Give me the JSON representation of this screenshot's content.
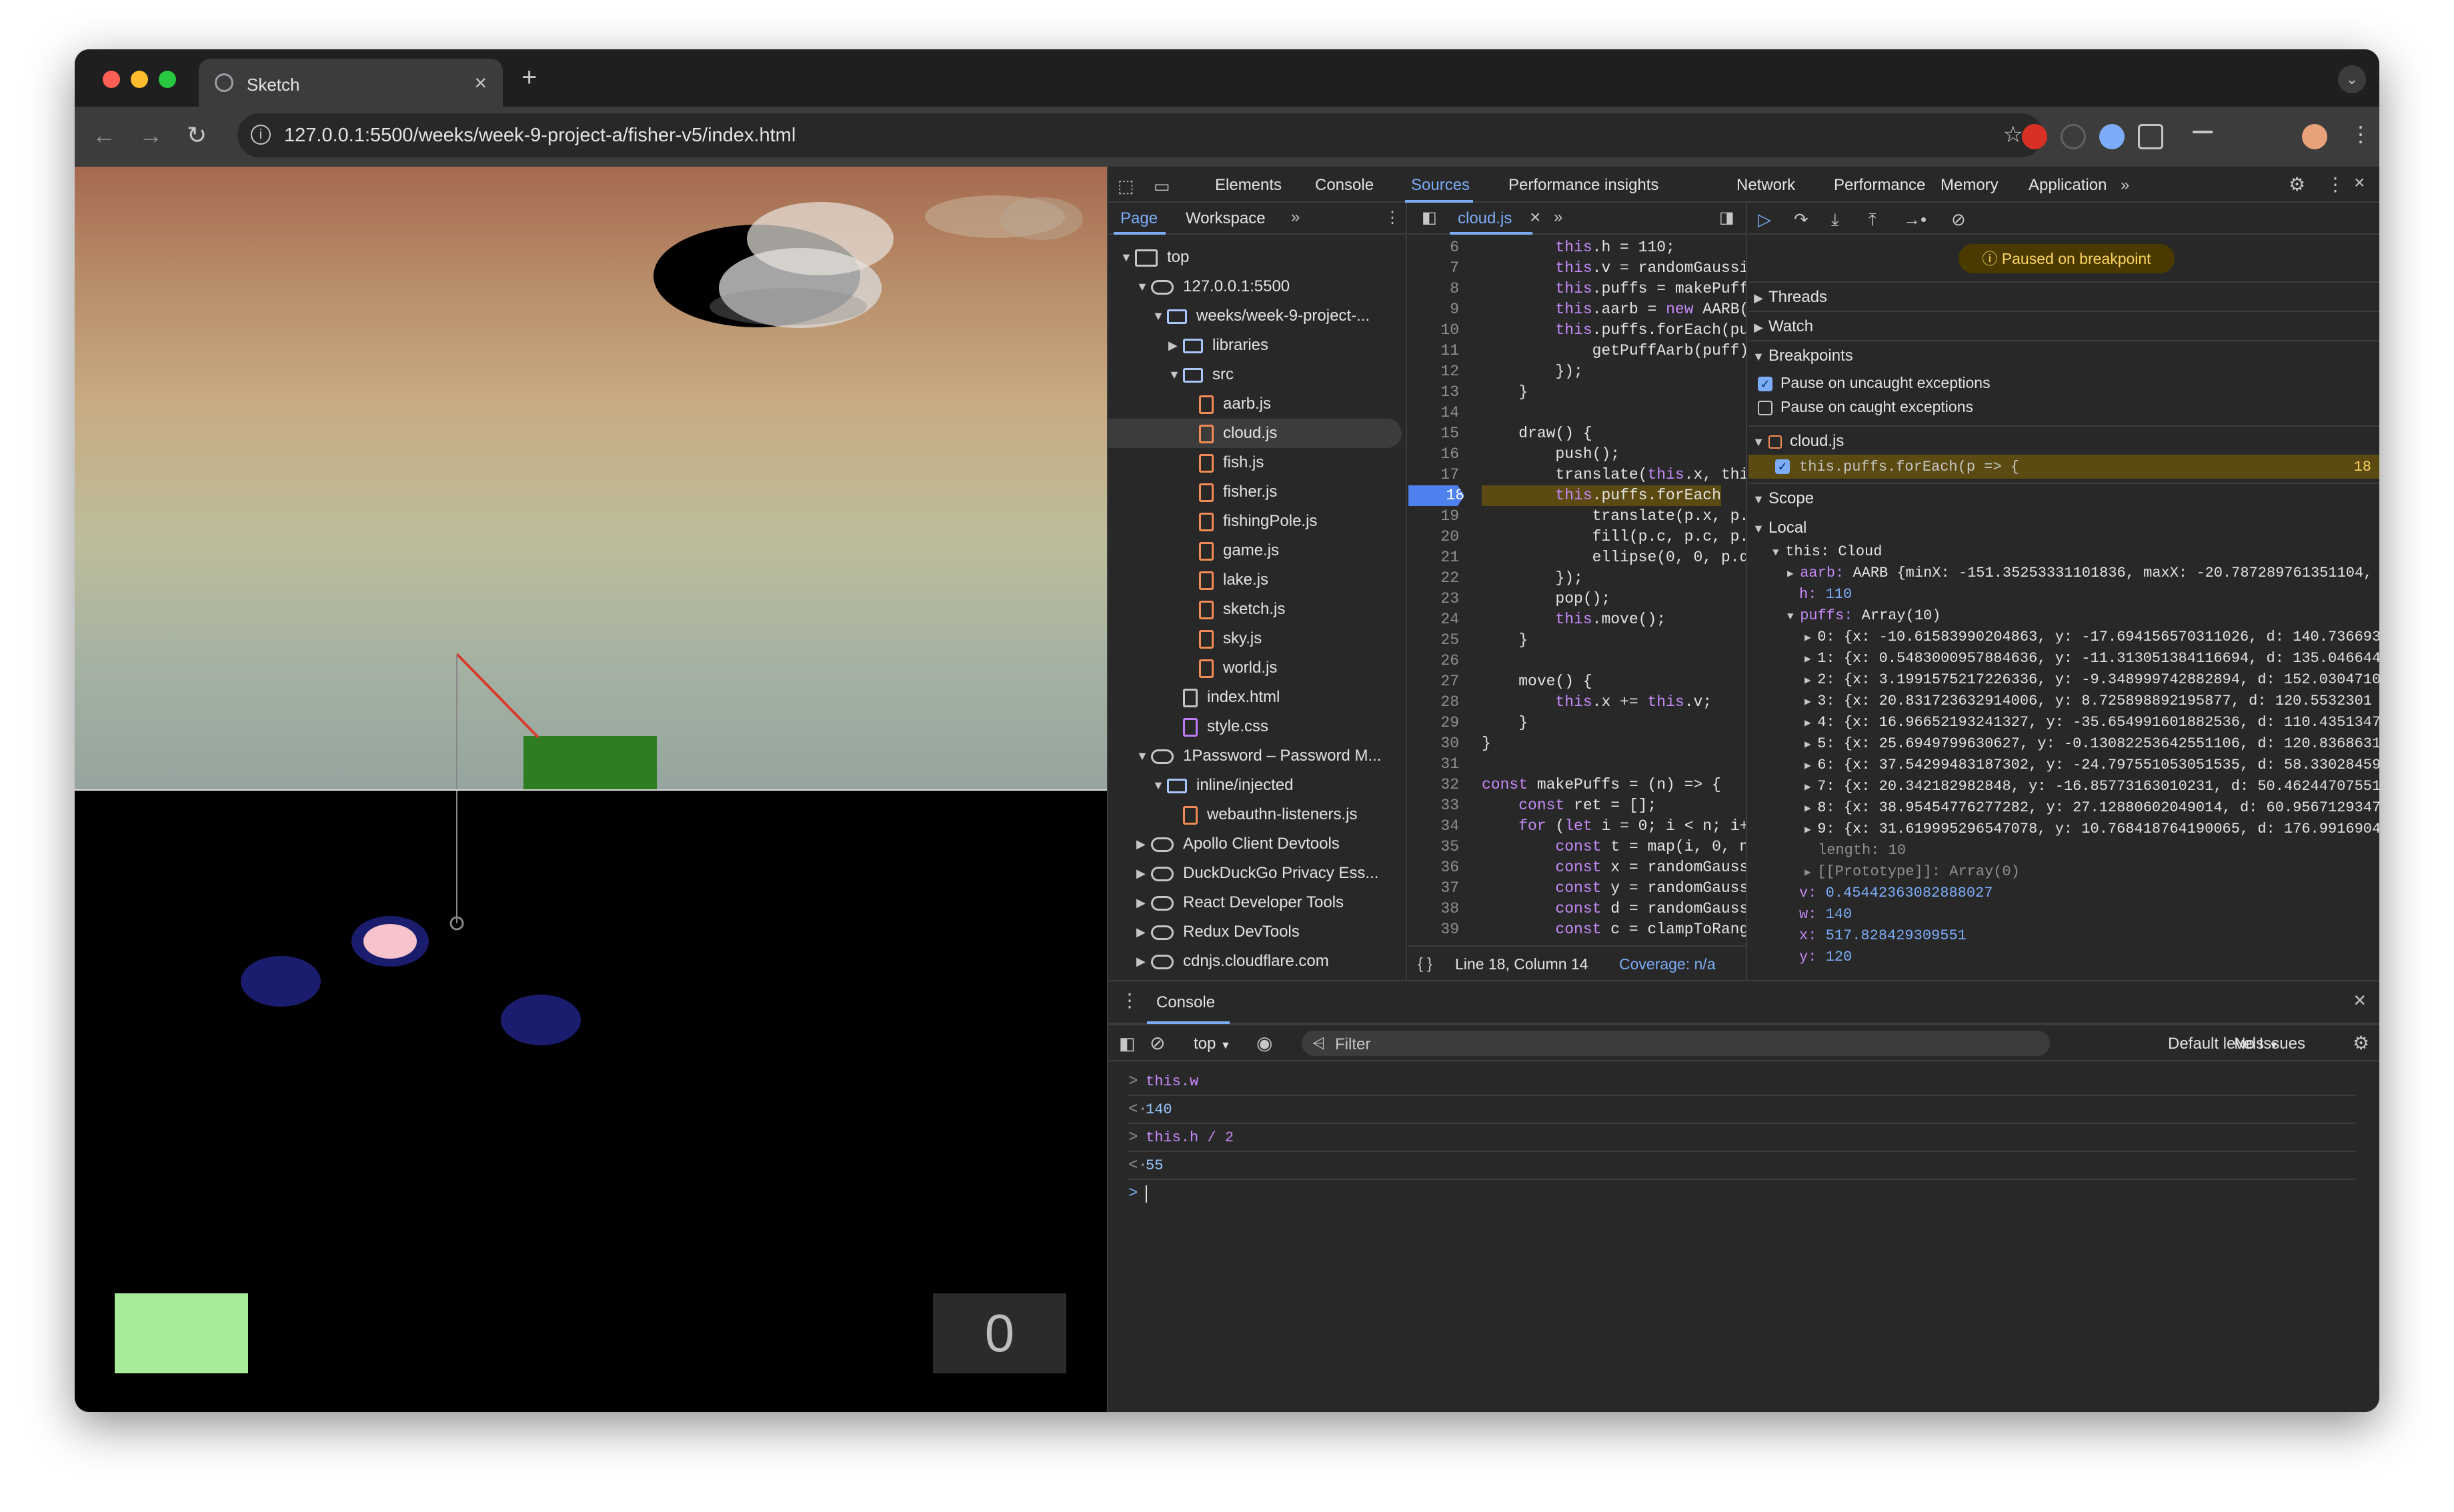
{
  "browser": {
    "tab_title": "Sketch",
    "url": "127.0.0.1:5500/weeks/week-9-project-a/fisher-v5/index.html"
  },
  "sketch": {
    "score": "0"
  },
  "devtools": {
    "tabs": [
      "Elements",
      "Console",
      "Sources",
      "Performance insights",
      "Network",
      "Performance",
      "Memory",
      "Application"
    ],
    "selected_tab": "Sources",
    "navigator_tabs": [
      "Page",
      "Workspace"
    ],
    "tree": [
      {
        "label": "top",
        "indent": 0,
        "kind": "frame",
        "arrow": "down"
      },
      {
        "label": "127.0.0.1:5500",
        "indent": 1,
        "kind": "cloud",
        "arrow": "down"
      },
      {
        "label": "weeks/week-9-project-...",
        "indent": 2,
        "kind": "folder",
        "arrow": "down"
      },
      {
        "label": "libraries",
        "indent": 3,
        "kind": "folder",
        "arrow": "right"
      },
      {
        "label": "src",
        "indent": 3,
        "kind": "folder",
        "arrow": "down"
      },
      {
        "label": "aarb.js",
        "indent": 4,
        "kind": "js"
      },
      {
        "label": "cloud.js",
        "indent": 4,
        "kind": "js",
        "selected": true
      },
      {
        "label": "fish.js",
        "indent": 4,
        "kind": "js"
      },
      {
        "label": "fisher.js",
        "indent": 4,
        "kind": "js"
      },
      {
        "label": "fishingPole.js",
        "indent": 4,
        "kind": "js"
      },
      {
        "label": "game.js",
        "indent": 4,
        "kind": "js"
      },
      {
        "label": "lake.js",
        "indent": 4,
        "kind": "js"
      },
      {
        "label": "sketch.js",
        "indent": 4,
        "kind": "js"
      },
      {
        "label": "sky.js",
        "indent": 4,
        "kind": "js"
      },
      {
        "label": "world.js",
        "indent": 4,
        "kind": "js"
      },
      {
        "label": "index.html",
        "indent": 3,
        "kind": "html"
      },
      {
        "label": "style.css",
        "indent": 3,
        "kind": "css"
      },
      {
        "label": "1Password – Password M...",
        "indent": 1,
        "kind": "cloud",
        "arrow": "down"
      },
      {
        "label": "inline/injected",
        "indent": 2,
        "kind": "folder",
        "arrow": "down"
      },
      {
        "label": "webauthn-listeners.js",
        "indent": 3,
        "kind": "js"
      },
      {
        "label": "Apollo Client Devtools",
        "indent": 1,
        "kind": "cloud",
        "arrow": "right"
      },
      {
        "label": "DuckDuckGo Privacy Ess...",
        "indent": 1,
        "kind": "cloud",
        "arrow": "right"
      },
      {
        "label": "React Developer Tools",
        "indent": 1,
        "kind": "cloud",
        "arrow": "right"
      },
      {
        "label": "Redux DevTools",
        "indent": 1,
        "kind": "cloud",
        "arrow": "right"
      },
      {
        "label": "cdnjs.cloudflare.com",
        "indent": 1,
        "kind": "cloud",
        "arrow": "right"
      }
    ],
    "editor": {
      "file_tab": "cloud.js",
      "lines": [
        {
          "n": "6",
          "code": "        this.h = 110;"
        },
        {
          "n": "7",
          "code": "        this.v = randomGaussi"
        },
        {
          "n": "8",
          "code": "        this.puffs = makePuff"
        },
        {
          "n": "9",
          "code": "        this.aarb = new AARB("
        },
        {
          "n": "10",
          "code": "        this.puffs.forEach(pu"
        },
        {
          "n": "11",
          "code": "            getPuffAarb(puff)"
        },
        {
          "n": "12",
          "code": "        });"
        },
        {
          "n": "13",
          "code": "    }"
        },
        {
          "n": "14",
          "code": ""
        },
        {
          "n": "15",
          "code": "    draw() {"
        },
        {
          "n": "16",
          "code": "        push();"
        },
        {
          "n": "17",
          "code": "        translate(this.x, thi"
        },
        {
          "n": "18",
          "code": "        this.puffs.forEach",
          "bp": true
        },
        {
          "n": "19",
          "code": "            translate(p.x, p."
        },
        {
          "n": "20",
          "code": "            fill(p.c, p.c, p."
        },
        {
          "n": "21",
          "code": "            ellipse(0, 0, p.d"
        },
        {
          "n": "22",
          "code": "        });"
        },
        {
          "n": "23",
          "code": "        pop();"
        },
        {
          "n": "24",
          "code": "        this.move();"
        },
        {
          "n": "25",
          "code": "    }"
        },
        {
          "n": "26",
          "code": ""
        },
        {
          "n": "27",
          "code": "    move() {"
        },
        {
          "n": "28",
          "code": "        this.x += this.v;"
        },
        {
          "n": "29",
          "code": "    }"
        },
        {
          "n": "30",
          "code": "}"
        },
        {
          "n": "31",
          "code": ""
        },
        {
          "n": "32",
          "code": "const makePuffs = (n) => {"
        },
        {
          "n": "33",
          "code": "    const ret = [];"
        },
        {
          "n": "34",
          "code": "    for (let i = 0; i < n; i+"
        },
        {
          "n": "35",
          "code": "        const t = map(i, 0, n"
        },
        {
          "n": "36",
          "code": "        const x = randomGauss"
        },
        {
          "n": "37",
          "code": "        const y = randomGauss"
        },
        {
          "n": "38",
          "code": "        const d = randomGauss"
        },
        {
          "n": "39",
          "code": "        const c = clampToRang"
        }
      ],
      "status_position": "Line 18, Column 14",
      "status_coverage": "Coverage: n/a"
    },
    "debugger": {
      "paused_label": "Paused on breakpoint",
      "threads": "Threads",
      "watch": "Watch",
      "breakpoints": "Breakpoints",
      "pause_uncaught": "Pause on uncaught exceptions",
      "pause_caught": "Pause on caught exceptions",
      "bp_file": "cloud.js",
      "bp_code": "this.puffs.forEach(p => {",
      "bp_line": "18",
      "scope": "Scope",
      "local": "Local",
      "this_label": "this: Cloud",
      "aarb_key": "aarb:",
      "aarb_val": "AARB {minX: -151.35253331101836, maxX: -20.787289761351104,",
      "h_key": "h:",
      "h_val": "110",
      "puffs_key": "puffs:",
      "puffs_val": "Array(10)",
      "puffs": [
        "0: {x: -10.61583990204863, y: -17.694156570311026, d: 140.736693",
        "1: {x: 0.5483000957884636, y: -11.313051384116694, d: 135.046644",
        "2: {x: 3.1991575217226336, y: -9.348999742882894, d: 152.0304710",
        "3: {x: 20.831723632914006, y: 8.725898892195877, d: 120.5532301",
        "4: {x: 16.96652193241327, y: -35.654991601882536, d: 110.4351347",
        "5: {x: 25.6949799630627, y: -0.13082253642551106, d: 120.8368631",
        "6: {x: 37.54299483187302, y: -24.797551053051535, d: 58.33028459",
        "7: {x: 20.342182982848, y: -16.85773163010231, d: 50.46244707551",
        "8: {x: 38.95454776277282, y: 27.12880602049014, d: 60.9567129347",
        "9: {x: 31.619995296547078, y: 10.768418764190065, d: 176.9916904"
      ],
      "length_row": "length: 10",
      "proto_row": "[[Prototype]]: Array(0)",
      "v_key": "v:",
      "v_val": "0.45442363082888027",
      "w_key": "w:",
      "w_val": "140",
      "x_key": "x:",
      "x_val": "517.828429309551",
      "y_key": "y:",
      "y_val": "120"
    },
    "console": {
      "drawer_tab": "Console",
      "context": "top",
      "filter_placeholder": "Filter",
      "levels": "Default levels",
      "issues": "No Issues",
      "entries": [
        {
          "prefix": ">",
          "text": "this.w",
          "kind": "input"
        },
        {
          "prefix": "<·",
          "text": "140",
          "kind": "output"
        },
        {
          "prefix": ">",
          "text": "this.h / 2",
          "kind": "input"
        },
        {
          "prefix": "<·",
          "text": "55",
          "kind": "output"
        }
      ],
      "prompt": ">"
    }
  }
}
